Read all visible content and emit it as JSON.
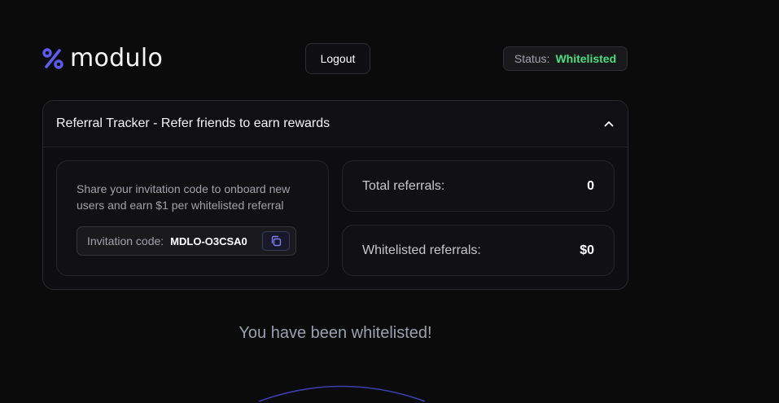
{
  "header": {
    "logo_text": "modulo",
    "logout_label": "Logout",
    "status_label": "Status:",
    "status_value": "Whitelisted"
  },
  "colors": {
    "accent": "#5b5bf0",
    "status_green": "#4ade80",
    "background": "#0b0b0c"
  },
  "referral": {
    "title": "Referral Tracker - Refer friends to earn rewards",
    "toggle_icon": "chevron-up-icon",
    "share_text": "Share your invitation code to onboard new users and earn $1 per whitelisted referral",
    "invite_label": "Invitation code:",
    "invite_code": "MDLO-O3CSA0",
    "copy_icon": "copy-icon",
    "stats": [
      {
        "label": "Total referrals:",
        "value": "0"
      },
      {
        "label": "Whitelisted referrals:",
        "value": "$0"
      }
    ]
  },
  "message": "You have been whitelisted!"
}
